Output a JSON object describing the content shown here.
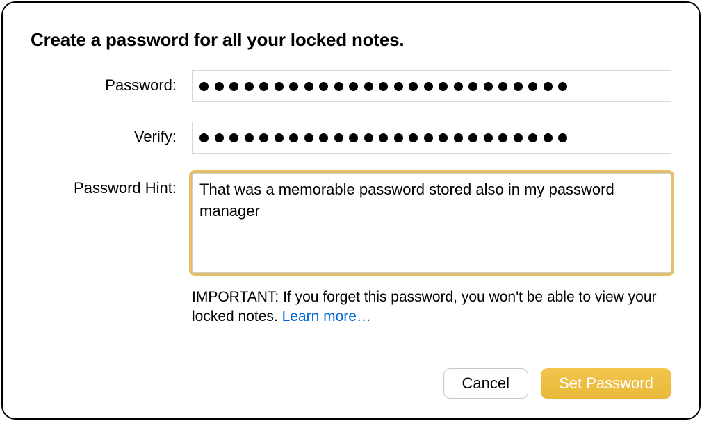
{
  "title": "Create a password for all your locked notes.",
  "labels": {
    "password": "Password:",
    "verify": "Verify:",
    "hint": "Password Hint:"
  },
  "fields": {
    "password_dot_count": 25,
    "verify_dot_count": 25,
    "hint_value": "That was a memorable password stored also in my password manager"
  },
  "info": {
    "text": "IMPORTANT: If you forget this password, you won't be able to view your locked notes. ",
    "learn_more": "Learn more…"
  },
  "buttons": {
    "cancel": "Cancel",
    "set_password": "Set Password"
  },
  "colors": {
    "accent": "#e9b93a",
    "link": "#0068da",
    "focus_ring": "#e2b24d"
  }
}
